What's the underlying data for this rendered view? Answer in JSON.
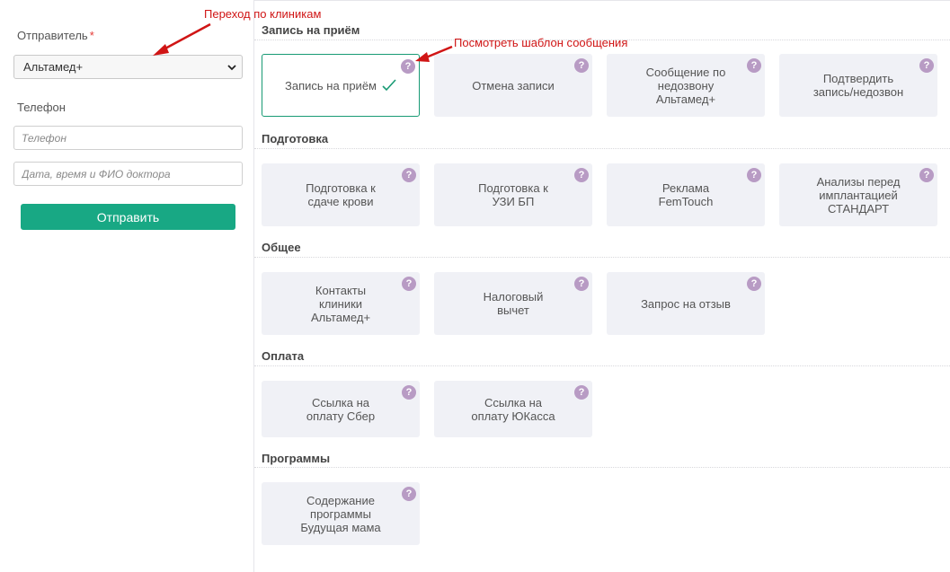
{
  "form": {
    "sender_label": "Отправитель",
    "required_mark": "*",
    "sender_value": "Альтамед+",
    "phone_label": "Телефон",
    "phone_placeholder": "Телефон",
    "details_placeholder": "Дата, время и ФИО доктора",
    "send_label": "Отправить"
  },
  "annotations": {
    "clinic_switch": "Переход по клиникам",
    "view_template": "Посмотреть шаблон сообщения"
  },
  "help_glyph": "?",
  "sections": [
    {
      "title": "Запись на приём",
      "cards": [
        {
          "label": "Запись на приём",
          "selected": true
        },
        {
          "label": "Отмена записи"
        },
        {
          "label": "Сообщение по\nнедозвону\nАльтамед+"
        },
        {
          "label": "Подтвердить\nзапись/недозвон"
        }
      ]
    },
    {
      "title": "Подготовка",
      "cards": [
        {
          "label": "Подготовка к\nсдаче крови"
        },
        {
          "label": "Подготовка к\nУЗИ БП"
        },
        {
          "label": "Реклама\nFemTouch"
        },
        {
          "label": "Анализы перед\nимплантацией\nСТАНДАРТ"
        }
      ]
    },
    {
      "title": "Общее",
      "cards": [
        {
          "label": "Контакты\nклиники\nАльтамед+"
        },
        {
          "label": "Налоговый\nвычет"
        },
        {
          "label": "Запрос на отзыв"
        }
      ]
    },
    {
      "title": "Оплата",
      "cards": [
        {
          "label": "Ссылка на\nоплату Сбер"
        },
        {
          "label": "Ссылка на\nоплату ЮКасса"
        }
      ]
    },
    {
      "title": "Программы",
      "cards": [
        {
          "label": "Содержание\nпрограммы\nБудущая мама"
        }
      ]
    }
  ],
  "colors": {
    "accent": "#18a884",
    "card_bg": "#f0f1f6",
    "help_badge": "#b89bc4",
    "annotation": "#d01515"
  }
}
